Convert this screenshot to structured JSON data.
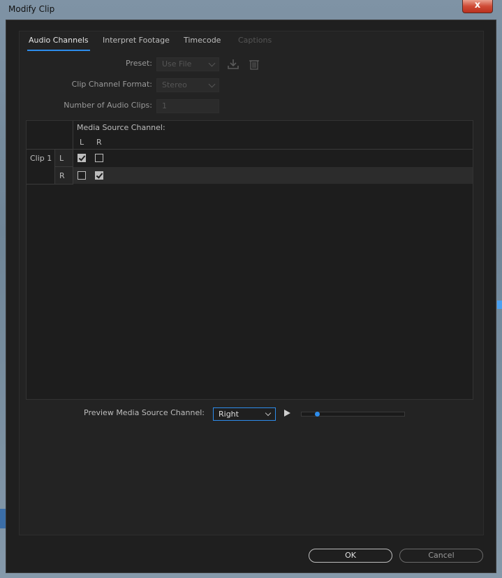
{
  "window": {
    "title": "Modify Clip",
    "close_label": "x"
  },
  "tabs": [
    {
      "label": "Audio Channels",
      "state": "active"
    },
    {
      "label": "Interpret Footage",
      "state": "normal"
    },
    {
      "label": "Timecode",
      "state": "normal"
    },
    {
      "label": "Captions",
      "state": "disabled"
    }
  ],
  "form": {
    "preset_label": "Preset:",
    "preset_value": "Use File",
    "format_label": "Clip Channel Format:",
    "format_value": "Stereo",
    "num_clips_label": "Number of Audio Clips:",
    "num_clips_value": "1"
  },
  "icons": {
    "save_preset": "download-icon",
    "delete_preset": "trash-icon"
  },
  "grid": {
    "header": "Media Source Channel:",
    "source_channels": [
      "L",
      "R"
    ],
    "clip_label": "Clip 1",
    "rows": [
      {
        "channel": "L",
        "checks": [
          true,
          false
        ]
      },
      {
        "channel": "R",
        "checks": [
          false,
          true
        ]
      }
    ]
  },
  "preview": {
    "label": "Preview Media Source Channel:",
    "selected": "Right",
    "slider_position": 0.12
  },
  "buttons": {
    "ok": "OK",
    "cancel": "Cancel"
  },
  "colors": {
    "accent": "#2d8ceb",
    "background": "#232323"
  }
}
